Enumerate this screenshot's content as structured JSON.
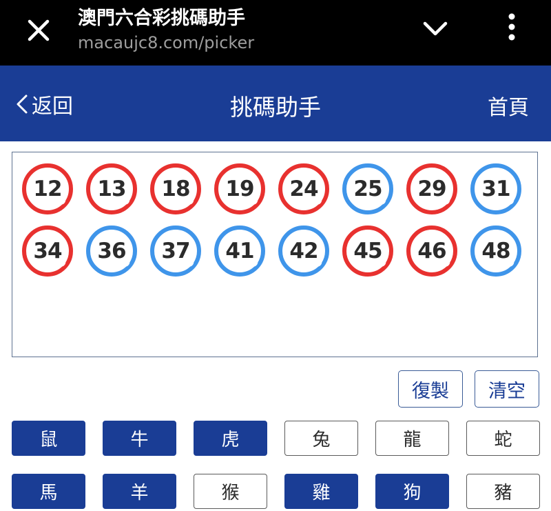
{
  "browser": {
    "page_title": "澳門六合彩挑碼助手",
    "url": "macaujc8.com/picker",
    "icons": [
      "close-icon",
      "chevron-down-icon",
      "more-vert-icon"
    ]
  },
  "header": {
    "back_label": "返回",
    "title": "挑碼助手",
    "home_label": "首頁",
    "background": "#1a3d95"
  },
  "colors": {
    "red_ball": "#e8312f",
    "blue_ball": "#3f95ea",
    "accent": "#1a3d95"
  },
  "picked_numbers": [
    {
      "value": "12",
      "color": "red"
    },
    {
      "value": "13",
      "color": "red"
    },
    {
      "value": "18",
      "color": "red"
    },
    {
      "value": "19",
      "color": "red"
    },
    {
      "value": "24",
      "color": "red"
    },
    {
      "value": "25",
      "color": "blue"
    },
    {
      "value": "29",
      "color": "red"
    },
    {
      "value": "31",
      "color": "blue"
    },
    {
      "value": "34",
      "color": "red"
    },
    {
      "value": "36",
      "color": "blue"
    },
    {
      "value": "37",
      "color": "blue"
    },
    {
      "value": "41",
      "color": "blue"
    },
    {
      "value": "42",
      "color": "blue"
    },
    {
      "value": "45",
      "color": "red"
    },
    {
      "value": "46",
      "color": "red"
    },
    {
      "value": "48",
      "color": "blue"
    }
  ],
  "actions": {
    "copy_label": "復製",
    "clear_label": "清空"
  },
  "zodiac": [
    {
      "label": "鼠",
      "selected": true
    },
    {
      "label": "牛",
      "selected": true
    },
    {
      "label": "虎",
      "selected": true
    },
    {
      "label": "兔",
      "selected": false
    },
    {
      "label": "龍",
      "selected": false
    },
    {
      "label": "蛇",
      "selected": false
    },
    {
      "label": "馬",
      "selected": true
    },
    {
      "label": "羊",
      "selected": true
    },
    {
      "label": "猴",
      "selected": false
    },
    {
      "label": "雞",
      "selected": true
    },
    {
      "label": "狗",
      "selected": true
    },
    {
      "label": "豬",
      "selected": false
    }
  ]
}
